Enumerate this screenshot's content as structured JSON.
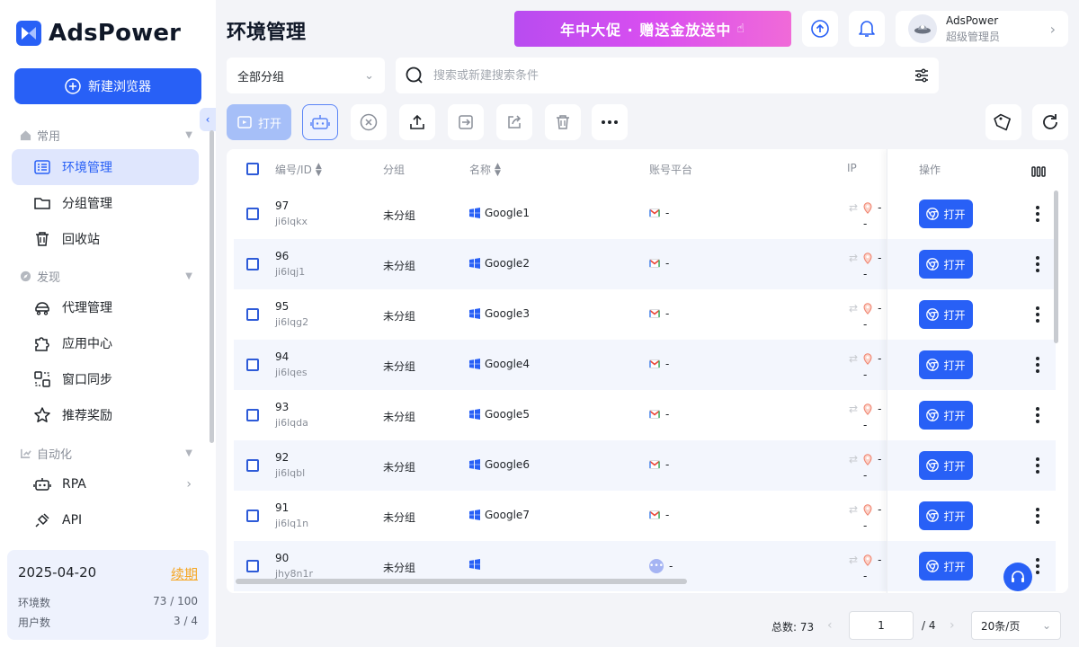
{
  "brand": {
    "name": "AdsPower"
  },
  "sidebar": {
    "new_browser": "新建浏览器",
    "sections": [
      {
        "label": "常用",
        "items": [
          {
            "label": "环境管理"
          },
          {
            "label": "分组管理"
          },
          {
            "label": "回收站"
          }
        ]
      },
      {
        "label": "发现",
        "items": [
          {
            "label": "代理管理"
          },
          {
            "label": "应用中心"
          },
          {
            "label": "窗口同步"
          },
          {
            "label": "推荐奖励"
          }
        ]
      },
      {
        "label": "自动化",
        "items": [
          {
            "label": "RPA"
          },
          {
            "label": "API"
          }
        ]
      }
    ],
    "account": {
      "expiry": "2025-04-20",
      "renew": "续期",
      "env_label": "环境数",
      "env_value": "73 / 100",
      "user_label": "用户数",
      "user_value": "3 / 4"
    }
  },
  "header": {
    "title": "环境管理",
    "promo": "年中大促 · 赠送金放送中",
    "user": {
      "name": "AdsPower",
      "role": "超级管理员"
    }
  },
  "filters": {
    "group": "全部分组",
    "search_placeholder": "搜索或新建搜索条件"
  },
  "toolbar": {
    "open": "打开"
  },
  "table": {
    "columns": {
      "id": "编号/ID",
      "group": "分组",
      "name": "名称",
      "platform": "账号平台",
      "ip": "IP",
      "actions": "操作"
    },
    "open_label": "打开",
    "rows": [
      {
        "num": "97",
        "id": "ji6lqkx",
        "group": "未分组",
        "name": "Google1",
        "platform": "-",
        "ip": "-",
        "ip2": "-",
        "pf": "gmail"
      },
      {
        "num": "96",
        "id": "ji6lqj1",
        "group": "未分组",
        "name": "Google2",
        "platform": "-",
        "ip": "-",
        "ip2": "-",
        "pf": "gmail"
      },
      {
        "num": "95",
        "id": "ji6lqg2",
        "group": "未分组",
        "name": "Google3",
        "platform": "-",
        "ip": "-",
        "ip2": "-",
        "pf": "gmail"
      },
      {
        "num": "94",
        "id": "ji6lqes",
        "group": "未分组",
        "name": "Google4",
        "platform": "-",
        "ip": "-",
        "ip2": "-",
        "pf": "gmail"
      },
      {
        "num": "93",
        "id": "ji6lqda",
        "group": "未分组",
        "name": "Google5",
        "platform": "-",
        "ip": "-",
        "ip2": "-",
        "pf": "gmail"
      },
      {
        "num": "92",
        "id": "ji6lqbl",
        "group": "未分组",
        "name": "Google6",
        "platform": "-",
        "ip": "-",
        "ip2": "-",
        "pf": "gmail"
      },
      {
        "num": "91",
        "id": "ji6lq1n",
        "group": "未分组",
        "name": "Google7",
        "platform": "-",
        "ip": "-",
        "ip2": "-",
        "pf": "gmail"
      },
      {
        "num": "90",
        "id": "jhy8n1r",
        "group": "未分组",
        "name": "",
        "platform": "-",
        "ip": "-",
        "ip2": "-",
        "pf": "other"
      }
    ]
  },
  "pagination": {
    "total": "总数: 73",
    "page": "1",
    "pages": "/ 4",
    "page_size": "20条/页"
  },
  "colors": {
    "accent": "#2860f6",
    "active_bg": "#dfe6fd",
    "renew": "#f5a623"
  }
}
